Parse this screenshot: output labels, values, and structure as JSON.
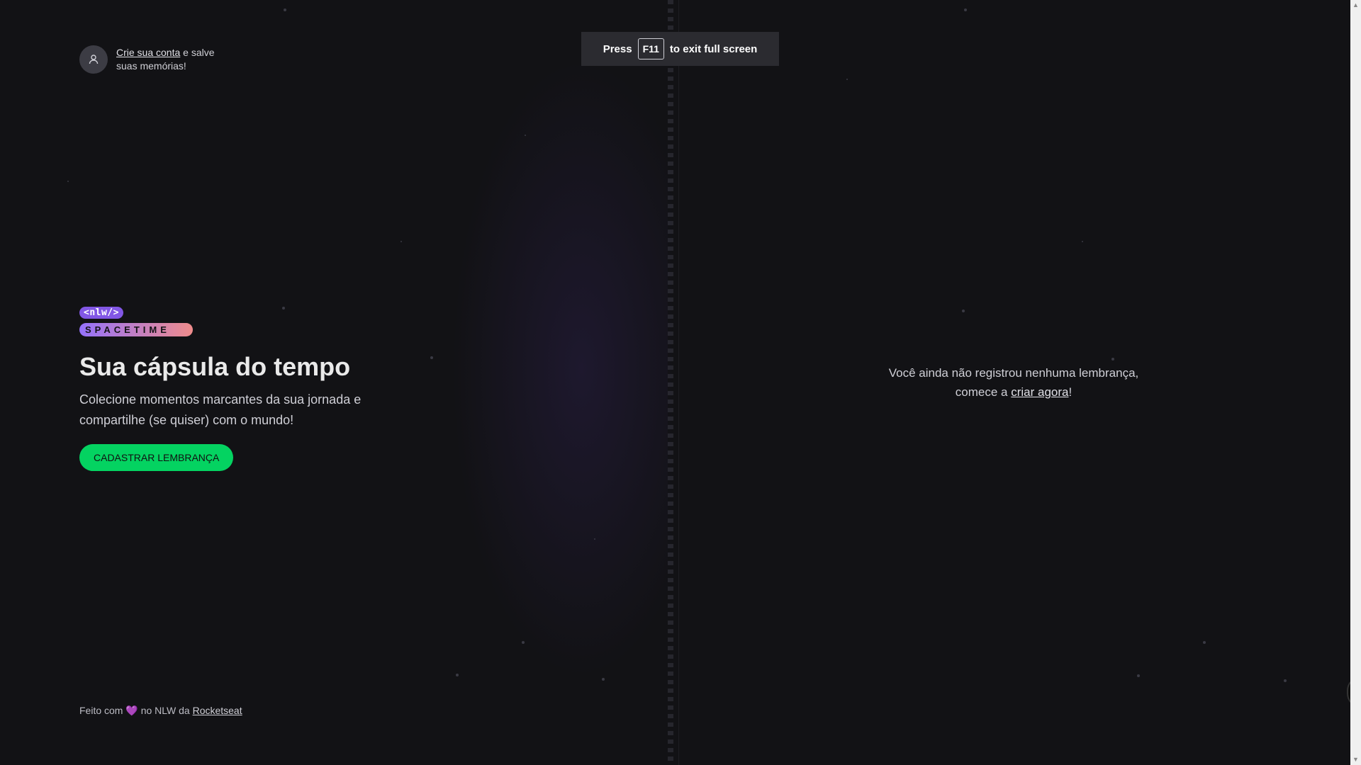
{
  "signin": {
    "link_label": "Crie sua conta",
    "rest_text": " e salve suas memórias!",
    "avatar_icon": "user-icon"
  },
  "logo": {
    "top": "<nlw/>",
    "bottom": "SPACETIME"
  },
  "hero": {
    "title": "Sua cápsula do tempo",
    "subtitle": "Colecione momentos marcantes da sua jornada e compartilhe (se quiser) com o mundo!",
    "cta_label": "Cadastrar lembrança"
  },
  "footer": {
    "prefix": "Feito com",
    "heart_icon": "heart-icon",
    "middle": "no NLW da",
    "link": "Rocketseat"
  },
  "empty_state": {
    "line1": "Você ainda não registrou nenhuma lembrança,",
    "line2_prefix": "comece a",
    "link": "criar agora",
    "line2_suffix": "!"
  },
  "fullscreen_toast": {
    "press": "Press",
    "key": "F11",
    "rest": "to exit full screen"
  },
  "colors": {
    "accent_green": "#04d361",
    "purple": "#8257e5",
    "background": "#121215"
  }
}
